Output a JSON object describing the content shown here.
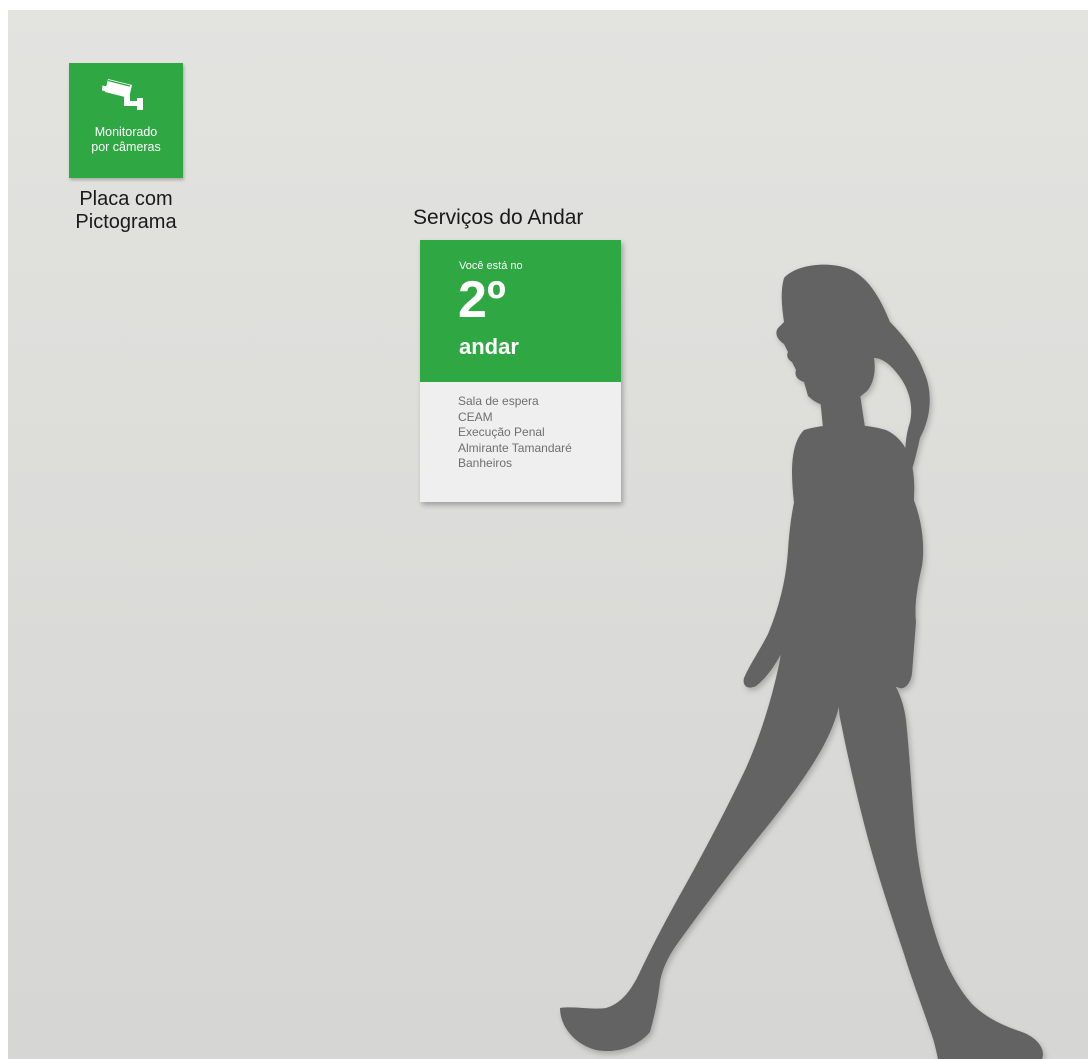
{
  "colors": {
    "sign_green": "#2fa844",
    "sign_panel": "#efefef",
    "silhouette": "#646464",
    "wall": "#dcdcda"
  },
  "pictogram_sign": {
    "icon": "security-camera-icon",
    "caption_line1": "Monitorado",
    "caption_line2": "por câmeras",
    "label_line1": "Placa com",
    "label_line2": "Pictograma"
  },
  "floor_sign": {
    "title": "Serviços do Andar",
    "you_are": "Você está no",
    "floor_number": "2º",
    "floor_word": "andar",
    "services": [
      "Sala de espera",
      "CEAM",
      "Execução Penal",
      "Almirante Tamandaré",
      "Banheiros"
    ]
  },
  "figure": {
    "icon": "walking-woman-silhouette"
  }
}
